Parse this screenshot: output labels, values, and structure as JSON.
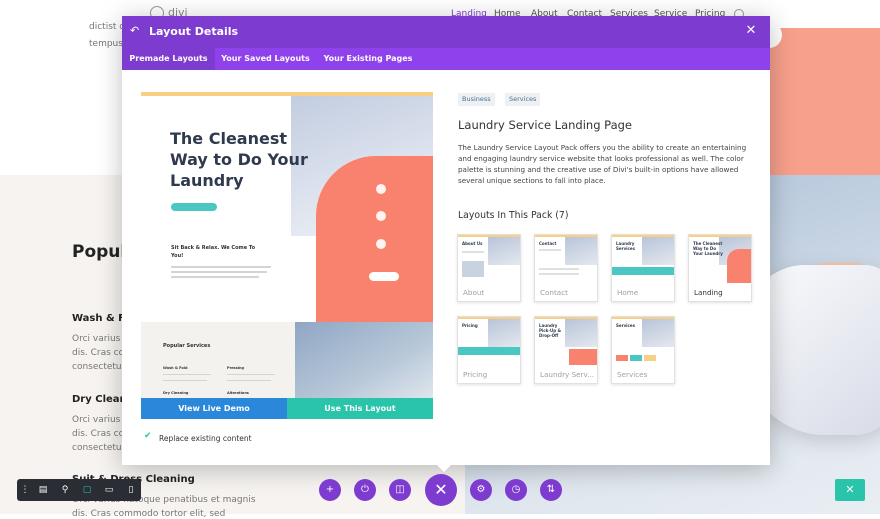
{
  "site": {
    "logo_text": "divi",
    "nav": [
      "Landing",
      "Home",
      "About",
      "Contact",
      "Services",
      "Service",
      "Pricing"
    ],
    "bg_snippets": {
      "intro_lines": [
        "dictist quis",
        "tempus"
      ],
      "popular_heading": "Popul",
      "services": [
        {
          "title": "Wash & Fo",
          "lines": [
            "Orci varius na",
            "dis. Cras comn",
            "consectetur."
          ]
        },
        {
          "title": "Dry Cleani",
          "lines": [
            "Orci varius na",
            "dis. Cras comn",
            "consectetur."
          ]
        },
        {
          "title": "Suit & Dress Cleaning",
          "lines": [
            "Orci varius natoque penatibus et magnis",
            "dis. Cras commodo tortor elit, sed"
          ]
        }
      ]
    }
  },
  "modal": {
    "title": "Layout Details",
    "tabs": [
      {
        "label": "Premade Layouts",
        "active": true
      },
      {
        "label": "Your Saved Layouts",
        "active": false
      },
      {
        "label": "Your Existing Pages",
        "active": false
      }
    ],
    "preview": {
      "headline": "The Cleanest Way to Do Your Laundry",
      "subhead": "Sit Back & Relax. We Come To You!",
      "popular": "Popular Services",
      "mini_items": [
        "Wash & Fold",
        "Pressing",
        "Dry Cleaning",
        "Alterations"
      ]
    },
    "buttons": {
      "demo": "View Live Demo",
      "use": "Use This Layout"
    },
    "replace_label": "Replace existing content",
    "replace_checked": true,
    "tags": [
      "Business",
      "Services"
    ],
    "layout_title": "Laundry Service Landing Page",
    "layout_description": "The Laundry Service Layout Pack offers you the ability to create an entertaining and engaging laundry service website that looks professional as well. The color palette is stunning and the creative use of Divi's built-in options have allowed several unique sections to fall into place.",
    "pack_title": "Layouts In This Pack (7)",
    "pack_layouts": [
      {
        "label": "About",
        "thumb_title": "About Us",
        "active": false
      },
      {
        "label": "Contact",
        "thumb_title": "Contact",
        "active": false
      },
      {
        "label": "Home",
        "thumb_title": "Laundry Services",
        "active": false
      },
      {
        "label": "Landing",
        "thumb_title": "The Cleanest Way to Do Your Laundry",
        "active": true
      },
      {
        "label": "Pricing",
        "thumb_title": "Pricing",
        "active": false
      },
      {
        "label": "Laundry Serv...",
        "thumb_title": "Laundry Pick-Up & Drop-Off",
        "active": false
      },
      {
        "label": "Services",
        "thumb_title": "Services",
        "active": false
      }
    ]
  },
  "colors": {
    "purple": "#7e3bd0",
    "tab_purple": "#8f42ec",
    "blue": "#2b87da",
    "teal": "#29c4a9",
    "coral": "#f9826e"
  }
}
